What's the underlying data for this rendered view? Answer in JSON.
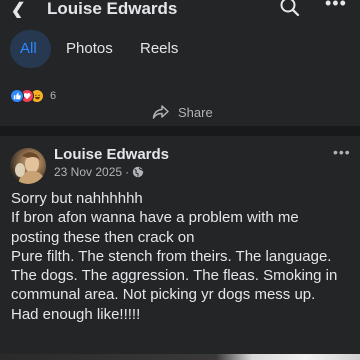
{
  "header": {
    "back_icon": "chevron-left-icon",
    "title": "Louise Edwards",
    "search_icon": "search-icon",
    "more_icon": "more-horizontal-icon"
  },
  "tabs": [
    {
      "label": "All",
      "active": true
    },
    {
      "label": "Photos",
      "active": false
    },
    {
      "label": "Reels",
      "active": false
    }
  ],
  "reactions": {
    "icons": [
      "like-icon",
      "love-icon",
      "haha-icon"
    ],
    "count": "6"
  },
  "actions": {
    "share_label": "Share"
  },
  "post": {
    "author": "Louise Edwards",
    "date": "23 Nov 2025",
    "separator": "·",
    "audience_icon": "globe-icon",
    "more_label": "•••",
    "lines": [
      "Sorry but nahhhhhh",
      "If bron afon wanna have a problem with me",
      "posting these then crack on",
      "Pure filth.   The stench from theirs.  The language.",
      "The dogs.  The aggression.  The fleas.  Smoking in",
      "communal area.  Not picking yr dogs mess up.",
      "Had enough like!!!!!"
    ]
  },
  "colors": {
    "background": "#18191a",
    "surface": "#242526",
    "accent": "#2d88ff",
    "text_primary": "#e4e6eb",
    "text_secondary": "#b0b3b8"
  }
}
